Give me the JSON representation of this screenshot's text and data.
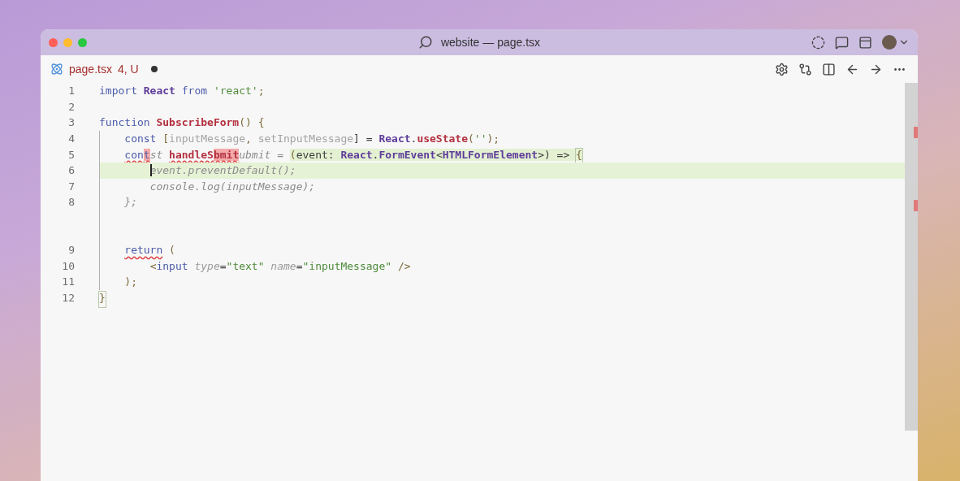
{
  "window": {
    "title": "website — page.tsx"
  },
  "tab": {
    "filename": "page.tsx",
    "status": "4, U",
    "modified": true
  },
  "lines": [
    {
      "number": "1",
      "guide": false,
      "highlighted": false,
      "tokens": [
        {
          "text": "import",
          "kind": "keyword"
        },
        {
          "text": " React",
          "kind": "type"
        },
        {
          "text": " from",
          "kind": "keyword"
        },
        {
          "text": " 'react'",
          "kind": "string"
        },
        {
          "text": ";",
          "kind": "punct"
        }
      ]
    },
    {
      "number": "2",
      "guide": false,
      "highlighted": false
    },
    {
      "number": "3",
      "guide": false,
      "highlighted": false,
      "tokens": [
        {
          "text": "function",
          "kind": "keyword"
        },
        {
          "text": " SubscribeForm",
          "kind": "func"
        },
        {
          "text": "() {",
          "kind": "punct"
        }
      ]
    },
    {
      "number": "4",
      "guide": true,
      "highlighted": false,
      "tokens": [
        {
          "text": "    const",
          "kind": "keyword"
        },
        {
          "text": " [",
          "kind": "punct"
        },
        {
          "text": "inputMessage",
          "kind": "unused"
        },
        {
          "text": ", ",
          "kind": "punct"
        },
        {
          "text": "setInputMessage",
          "kind": "unused"
        },
        {
          "text": "] = ",
          "kind": "plain"
        },
        {
          "text": "React",
          "kind": "type"
        },
        {
          "text": ".",
          "kind": "plain"
        },
        {
          "text": "useState",
          "kind": "func"
        },
        {
          "text": "(",
          "kind": "punct"
        },
        {
          "text": "''",
          "kind": "string"
        },
        {
          "text": ");",
          "kind": "punct"
        }
      ]
    },
    {
      "number": "5",
      "guide": true,
      "highlighted": false,
      "tokens": [
        {
          "text": "    con",
          "kind": "keyword",
          "squiggle": true
        },
        {
          "text": "t",
          "kind": "keyword",
          "squiggle": true,
          "deleted": true
        },
        {
          "text": "st ",
          "kind": "ghost"
        },
        {
          "text": "handleS",
          "kind": "func",
          "squiggle": true
        },
        {
          "text": "bmit",
          "kind": "func",
          "squiggle": true,
          "deleted": true
        },
        {
          "text": "ubmit = ",
          "kind": "ghost"
        },
        {
          "text": "(",
          "kind": "punct",
          "inserted": true
        },
        {
          "text": "event: ",
          "kind": "plain",
          "inserted": true
        },
        {
          "text": "React",
          "kind": "type",
          "inserted": true
        },
        {
          "text": ".",
          "kind": "plain",
          "inserted": true
        },
        {
          "text": "FormEvent",
          "kind": "type",
          "inserted": true
        },
        {
          "text": "<",
          "kind": "plain",
          "inserted": true
        },
        {
          "text": "HTMLFormElement",
          "kind": "type",
          "inserted": true
        },
        {
          "text": ">) => ",
          "kind": "plain",
          "inserted": true
        },
        {
          "text": "{",
          "kind": "match",
          "inserted": true
        }
      ]
    },
    {
      "number": "6",
      "guide": true,
      "highlighted": true,
      "tokens": [
        {
          "text": "        event.preventDefault();",
          "kind": "ghost",
          "cursor": true
        }
      ]
    },
    {
      "number": "7",
      "guide": true,
      "highlighted": false,
      "tokens": [
        {
          "text": "        console.log(inputMessage);",
          "kind": "ghost"
        }
      ]
    },
    {
      "number": "8",
      "guide": true,
      "highlighted": false,
      "tokens": [
        {
          "text": "    };",
          "kind": "ghost"
        }
      ]
    },
    {
      "guide": true,
      "highlighted": false
    },
    {
      "guide": true,
      "highlighted": false
    },
    {
      "number": "9",
      "guide": true,
      "highlighted": false,
      "tokens": [
        {
          "text": "    return",
          "kind": "keyword",
          "squiggle": true
        },
        {
          "text": " (",
          "kind": "punct"
        }
      ]
    },
    {
      "number": "10",
      "guide": true,
      "highlighted": false,
      "tokens": [
        {
          "text": "        <",
          "kind": "punct"
        },
        {
          "text": "input",
          "kind": "tag"
        },
        {
          "text": " type",
          "kind": "attr"
        },
        {
          "text": "=",
          "kind": "plain"
        },
        {
          "text": "\"text\"",
          "kind": "string"
        },
        {
          "text": " name",
          "kind": "attr"
        },
        {
          "text": "=",
          "kind": "plain"
        },
        {
          "text": "\"inputMessage\"",
          "kind": "string"
        },
        {
          "text": " />",
          "kind": "punct"
        }
      ]
    },
    {
      "number": "11",
      "guide": true,
      "highlighted": false,
      "tokens": [
        {
          "text": "    );",
          "kind": "punct"
        }
      ]
    },
    {
      "number": "12",
      "guide": false,
      "highlighted": false,
      "tokens": [
        {
          "text": "}",
          "kind": "match"
        }
      ]
    }
  ]
}
